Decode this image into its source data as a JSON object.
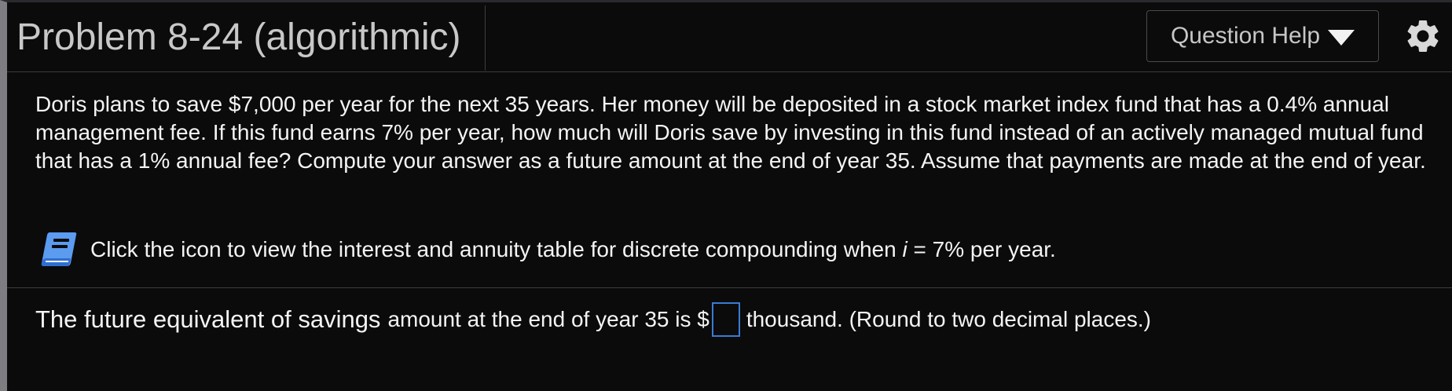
{
  "header": {
    "title": "Problem 8-24 (algorithmic)",
    "help_button_label": "Question Help",
    "help_dropdown_icon": "caret-down-icon",
    "settings_icon": "gear-icon"
  },
  "question": {
    "text": "Doris plans to save $7,000 per year for the next 35 years. Her money will be deposited in a stock market index fund that has a 0.4% annual management fee. If this fund earns 7% per year, how much will Doris save by investing in this fund instead of an actively managed mutual fund that has a 1% annual fee? Compute your answer as a future amount at the end of year 35. Assume that payments are made at the end of year."
  },
  "hint": {
    "icon": "book-icon",
    "text_before": "Click the icon to view the interest and annuity table for discrete compounding when ",
    "variable": "i",
    "text_after": " = 7% per year."
  },
  "answer": {
    "lead": "The future equivalent of savings",
    "middle": "amount at the end of year 35 is $",
    "value": "",
    "tail": "thousand. (Round to two decimal places.)"
  },
  "colors": {
    "background": "#0b0b0c",
    "answer_box_border": "#3a7bd5",
    "book_icon": "#5b9bf0"
  }
}
